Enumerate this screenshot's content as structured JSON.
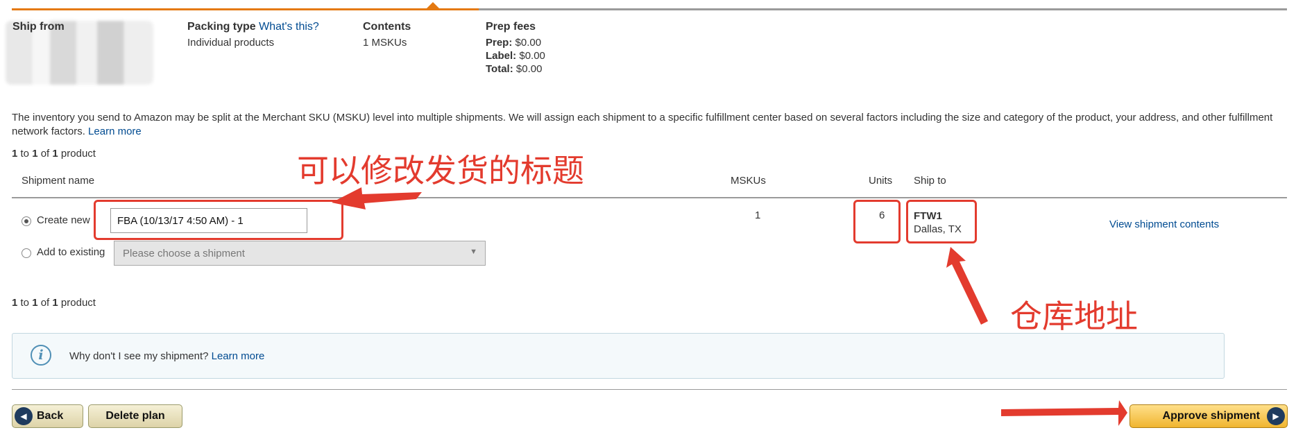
{
  "header": {
    "ship_from": "Ship from",
    "packing_type_label": "Packing type",
    "packing_type_link": "What's this?",
    "packing_type_value": "Individual products",
    "contents_label": "Contents",
    "contents_value": "1 MSKUs",
    "prep_fees_label": "Prep fees",
    "prep_label": "Prep:",
    "prep_value": "$0.00",
    "label_label": "Label:",
    "label_value": "$0.00",
    "total_label": "Total:",
    "total_value": "$0.00"
  },
  "note": {
    "text": "The inventory you send to Amazon may be split at the Merchant SKU (MSKU) level into multiple shipments. We will assign each shipment to a specific fulfillment center based on several factors including the size and category of the product, your address, and other fulfillment network factors.",
    "link": "Learn more"
  },
  "pagination": {
    "from": "1",
    "to_word": "to",
    "to": "1",
    "of_word": "of",
    "total": "1",
    "unit": "product"
  },
  "table": {
    "headers": {
      "shipment_name": "Shipment name",
      "mskus": "MSKUs",
      "units": "Units",
      "ship_to": "Ship to"
    },
    "row": {
      "create_new_label": "Create new",
      "shipment_name_value": "FBA (10/13/17 4:50 AM) - 1",
      "add_existing_label": "Add to existing",
      "select_placeholder": "Please choose a shipment",
      "mskus": "1",
      "units": "6",
      "ship_to_code": "FTW1",
      "ship_to_city": "Dallas, TX",
      "view_contents": "View shipment contents"
    }
  },
  "info": {
    "question": "Why don't I see my shipment?",
    "link": "Learn more"
  },
  "buttons": {
    "back": "Back",
    "delete_plan": "Delete plan",
    "approve": "Approve shipment"
  },
  "annotations": {
    "title_note": "可以修改发货的标题",
    "warehouse_note": "仓库地址"
  },
  "colors": {
    "accent": "#e47911",
    "link": "#004b91",
    "annotation": "#e33b2e"
  }
}
